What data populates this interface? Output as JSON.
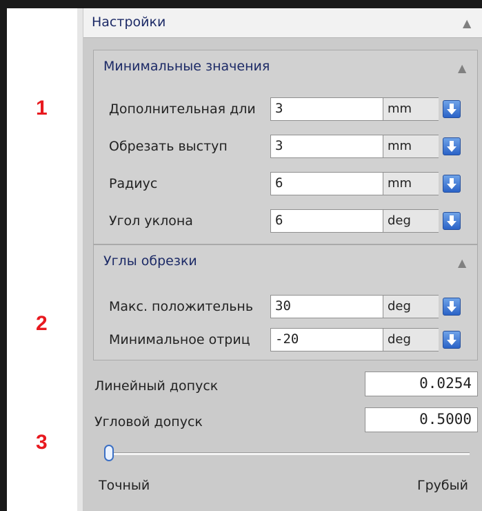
{
  "markers": [
    "1",
    "2",
    "3"
  ],
  "panel": {
    "title": "Настройки"
  },
  "group_min": {
    "title": "Минимальные значения",
    "rows": [
      {
        "label": "Дополнительная дли",
        "value": "3",
        "unit": "mm"
      },
      {
        "label": "Обрезать выступ",
        "value": "3",
        "unit": "mm"
      },
      {
        "label": "Радиус",
        "value": "6",
        "unit": "mm"
      },
      {
        "label": "Угол уклона",
        "value": "6",
        "unit": "deg"
      }
    ]
  },
  "group_angles": {
    "title": "Углы обрезки",
    "rows": [
      {
        "label": "Макс. положительнь",
        "value": "30",
        "unit": "deg"
      },
      {
        "label": "Минимальное отриц",
        "value": "-20",
        "unit": "deg"
      }
    ]
  },
  "linear_tol": {
    "label": "Линейный допуск",
    "value": "0.0254"
  },
  "angular_tol": {
    "label": "Угловой допуск",
    "value": "0.5000"
  },
  "slider": {
    "level": 0,
    "min_label": "Точный",
    "max_label": "Грубый"
  },
  "colors": {
    "marker": "#e8191f",
    "title": "#1c2a66",
    "dropdown": "#2b63c7"
  },
  "icons": {
    "collapse": "chevron-up-icon",
    "dropdown": "arrow-down-icon"
  }
}
